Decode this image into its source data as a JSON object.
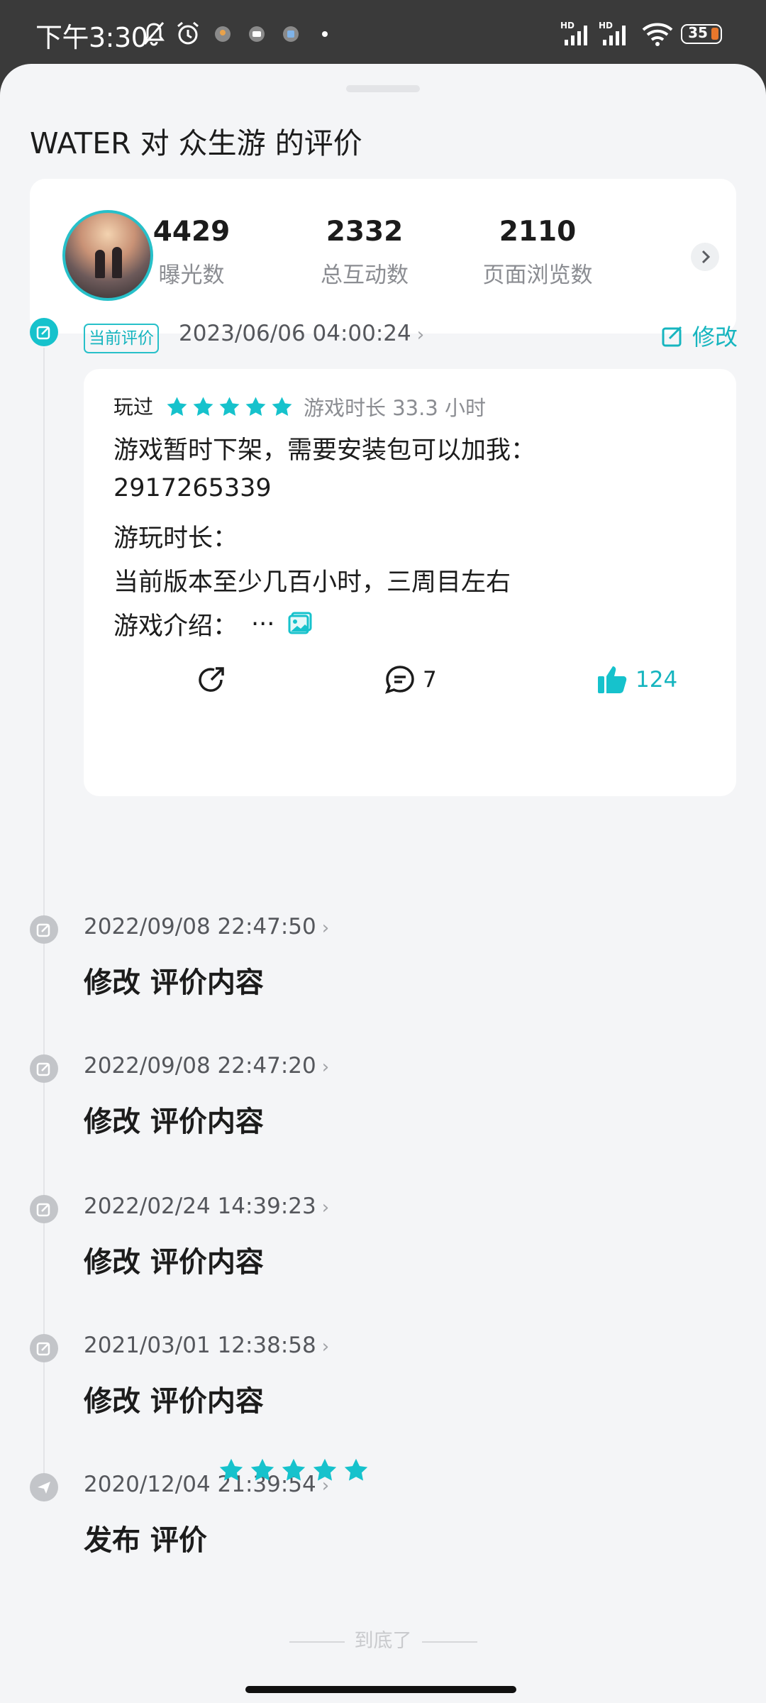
{
  "status_bar": {
    "time": "下午3:30",
    "icons": [
      "mute-bell-icon",
      "alarm-icon",
      "location-app-icon",
      "shield-app-icon",
      "app-icon",
      "signal-hd-icon",
      "signal-hd-icon",
      "wifi-icon"
    ],
    "battery": "35"
  },
  "header": {
    "title": "WATER 对 众生游 的评价"
  },
  "stats": {
    "avatar": "user-avatar",
    "items": [
      {
        "value": "4429",
        "label": "曝光数"
      },
      {
        "value": "2332",
        "label": "总互动数"
      },
      {
        "value": "2110",
        "label": "页面浏览数"
      }
    ]
  },
  "current_review": {
    "tag": "当前评价",
    "date": "2023/06/06 04:00:24",
    "edit_label": "修改",
    "played_label": "玩过",
    "rating": 5,
    "play_time": "游戏时长 33.3 小时",
    "lines": [
      "游戏暂时下架，需要安装包可以加我：",
      "2917265339",
      "游玩时长：",
      "当前版本至少几百小时，三周目左右",
      "游戏介绍："
    ],
    "more": "...",
    "comment_count": "7",
    "like_count": "124"
  },
  "history": [
    {
      "date": "2022/09/08 22:47:50",
      "title": "修改 评价内容"
    },
    {
      "date": "2022/09/08 22:47:20",
      "title": "修改 评价内容"
    },
    {
      "date": "2022/02/24 14:39:23",
      "title": "修改 评价内容"
    },
    {
      "date": "2021/03/01 12:38:58",
      "title": "修改 评价内容"
    },
    {
      "date": "2020/12/04 21:39:54",
      "title": "发布 评价",
      "rating": 5
    }
  ],
  "footer": {
    "end_text": "到底了"
  },
  "colors": {
    "accent": "#16c2cc",
    "sheet_bg": "#f4f5f7",
    "status_bar_bg": "#3a3a3a"
  }
}
